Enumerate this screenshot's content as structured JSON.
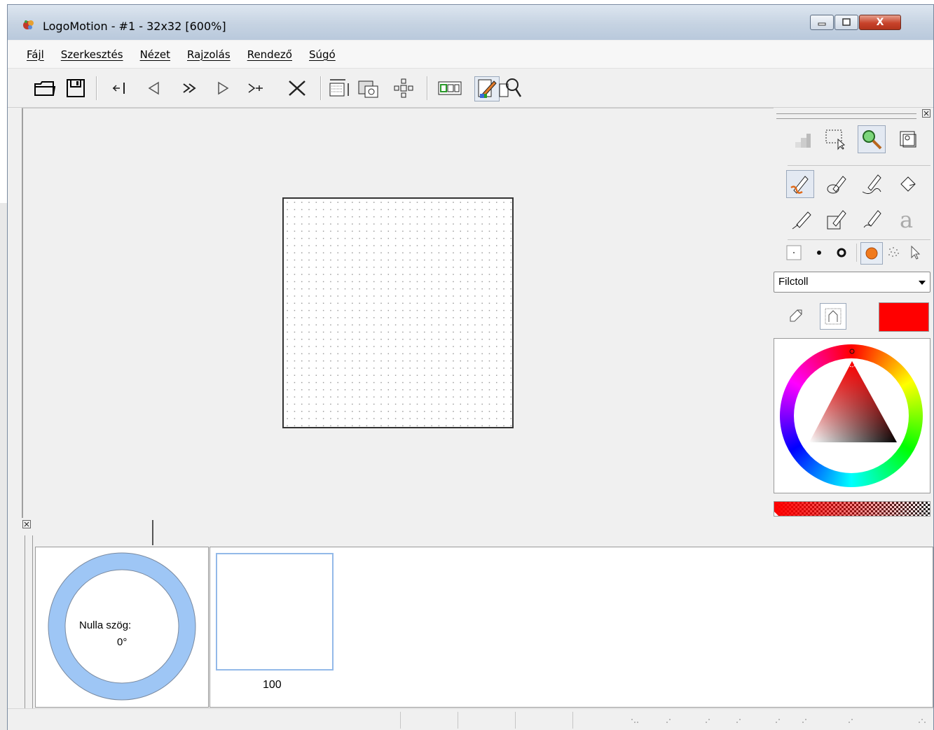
{
  "window": {
    "title": "LogoMotion - #1 - 32x32 [600%]",
    "close_glyph": "X"
  },
  "menu": [
    {
      "label": "Fájl"
    },
    {
      "label": "Szerkesztés"
    },
    {
      "label": "Nézet"
    },
    {
      "label": "Rajzolás"
    },
    {
      "label": "Rendező"
    },
    {
      "label": "Súgó"
    }
  ],
  "toolbar": {
    "icons": [
      "open-folder-icon",
      "save-icon",
      "first-frame-icon",
      "prev-frame-icon",
      "play-icon",
      "next-frame-icon",
      "last-frame-icon",
      "delete-frame-icon",
      "resize-canvas-icon",
      "image-properties-icon",
      "transform-icon",
      "onion-skin-icon",
      "edit-pencil-icon",
      "zoom-preview-icon"
    ]
  },
  "tool_panel": {
    "brush_mode": "Filctoll",
    "current_color": "#ff0000"
  },
  "bottom_panel": {
    "angle_label": "Nulla szög:",
    "angle_value": "0°",
    "frame_duration": "100"
  },
  "colors": {
    "accent": "#93b9e8",
    "ring": "#9ec6f5",
    "selected_color": "#ff0000"
  }
}
